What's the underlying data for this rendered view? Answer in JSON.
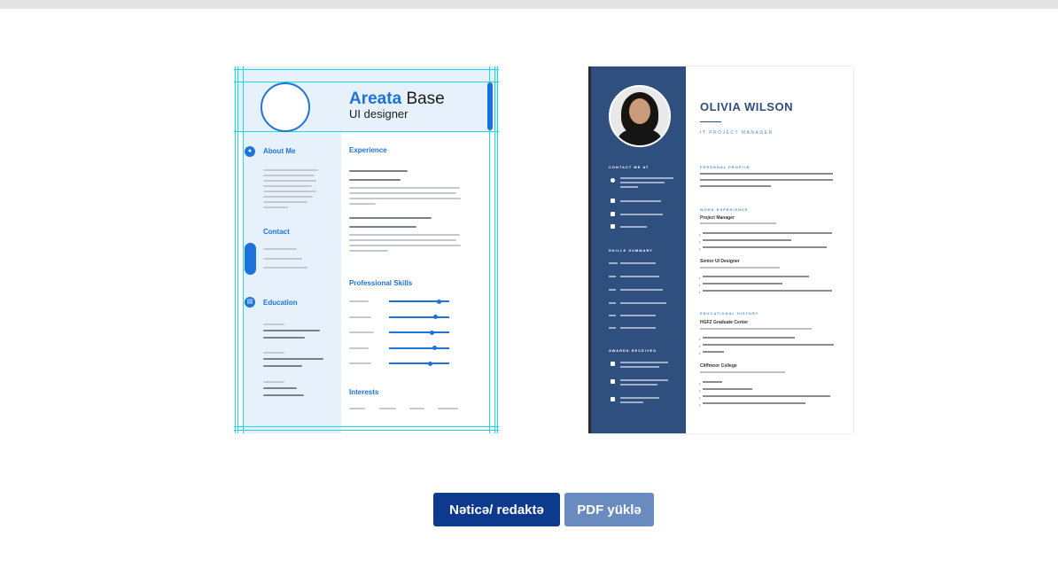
{
  "templates": [
    {
      "name_first": "Areata",
      "name_last": "Base",
      "role": "UI designer",
      "sections": {
        "about": "About Me",
        "contact": "Contact",
        "education": "Education",
        "experience": "Experience",
        "skills": "Professional Skills",
        "interests": "Interests"
      },
      "skill_levels": [
        0.83,
        0.77,
        0.71,
        0.75,
        0.68
      ],
      "accent_color": "#1e73d8"
    },
    {
      "name": "OLIVIA WILSON",
      "title": "IT PROJECT MANAGER",
      "side_headers": [
        "CONTACT ME AT",
        "SKILLS SUMMARY",
        "AWARDS RECEIVED"
      ],
      "main_headers": [
        "PERSONAL PROFILE",
        "WORK EXPERIENCE",
        "EDUCATIONAL HISTORY"
      ],
      "jobs": [
        "Project Manager",
        "Senior UI Designer"
      ],
      "schools": [
        "HGFZ Graduate Center",
        "Cliffmoor College"
      ],
      "accent_color": "#2f4f7f"
    }
  ],
  "buttons": {
    "result_edit": "Nəticə/ redaktə",
    "pdf_download": "PDF yüklə"
  }
}
